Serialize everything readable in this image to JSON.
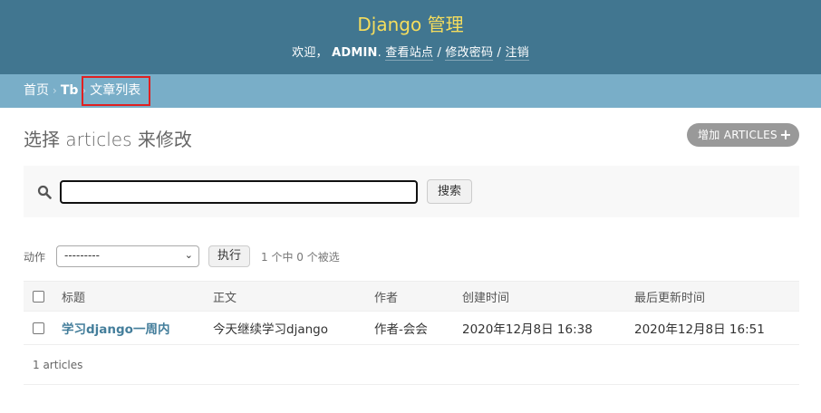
{
  "header": {
    "site_name": "Django 管理",
    "welcome": "欢迎，",
    "username": "ADMIN",
    "view_site": "查看站点",
    "change_password": "修改密码",
    "logout": "注销",
    "sep": " / "
  },
  "breadcrumbs": {
    "home": "首页",
    "app": "Tb",
    "current": "文章列表",
    "sep": "›"
  },
  "page": {
    "title": "选择 articles 来修改",
    "add_button": "增加 ARTICLES"
  },
  "search": {
    "value": "",
    "button": "搜索"
  },
  "actions": {
    "label": "动作",
    "selected_option": "---------",
    "go_button": "执行",
    "counter": "1 个中 0 个被选"
  },
  "table": {
    "columns": [
      "标题",
      "正文",
      "作者",
      "创建时间",
      "最后更新时间"
    ],
    "rows": [
      {
        "title": "学习django一周内",
        "body": "今天继续学习django",
        "author": "作者-会会",
        "created": "2020年12月8日 16:38",
        "updated": "2020年12月8日 16:51"
      }
    ]
  },
  "paginator": {
    "text": "1 articles"
  }
}
